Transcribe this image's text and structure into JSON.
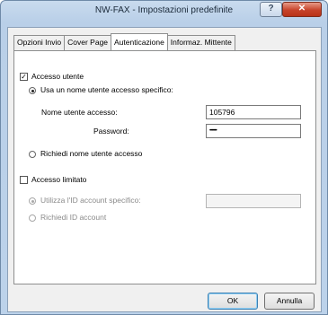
{
  "window": {
    "title": "NW-FAX - Impostazioni predefinite",
    "help_label": "?",
    "close_label": "✕"
  },
  "tabs": [
    {
      "label": "Opzioni Invio"
    },
    {
      "label": "Cover Page"
    },
    {
      "label": "Autenticazione"
    },
    {
      "label": "Informaz. Mittente"
    }
  ],
  "active_tab": "Autenticazione",
  "auth": {
    "user_access_label": "Accesso utente",
    "user_access_checked": true,
    "use_specific_label": "Usa un nome utente accesso specifico:",
    "use_specific_selected": true,
    "username_label": "Nome utente accesso:",
    "username_value": "105796",
    "password_label": "Password:",
    "password_value": "•••••••",
    "ask_username_label": "Richiedi nome utente accesso",
    "ask_username_selected": false,
    "limited_access_label": "Accesso limitato",
    "limited_access_checked": false,
    "use_account_id_label": "Utilizza l'ID account specifico:",
    "use_account_id_value": "",
    "ask_account_id_label": "Richiedi ID account"
  },
  "buttons": {
    "ok": "OK",
    "cancel": "Annulla"
  }
}
